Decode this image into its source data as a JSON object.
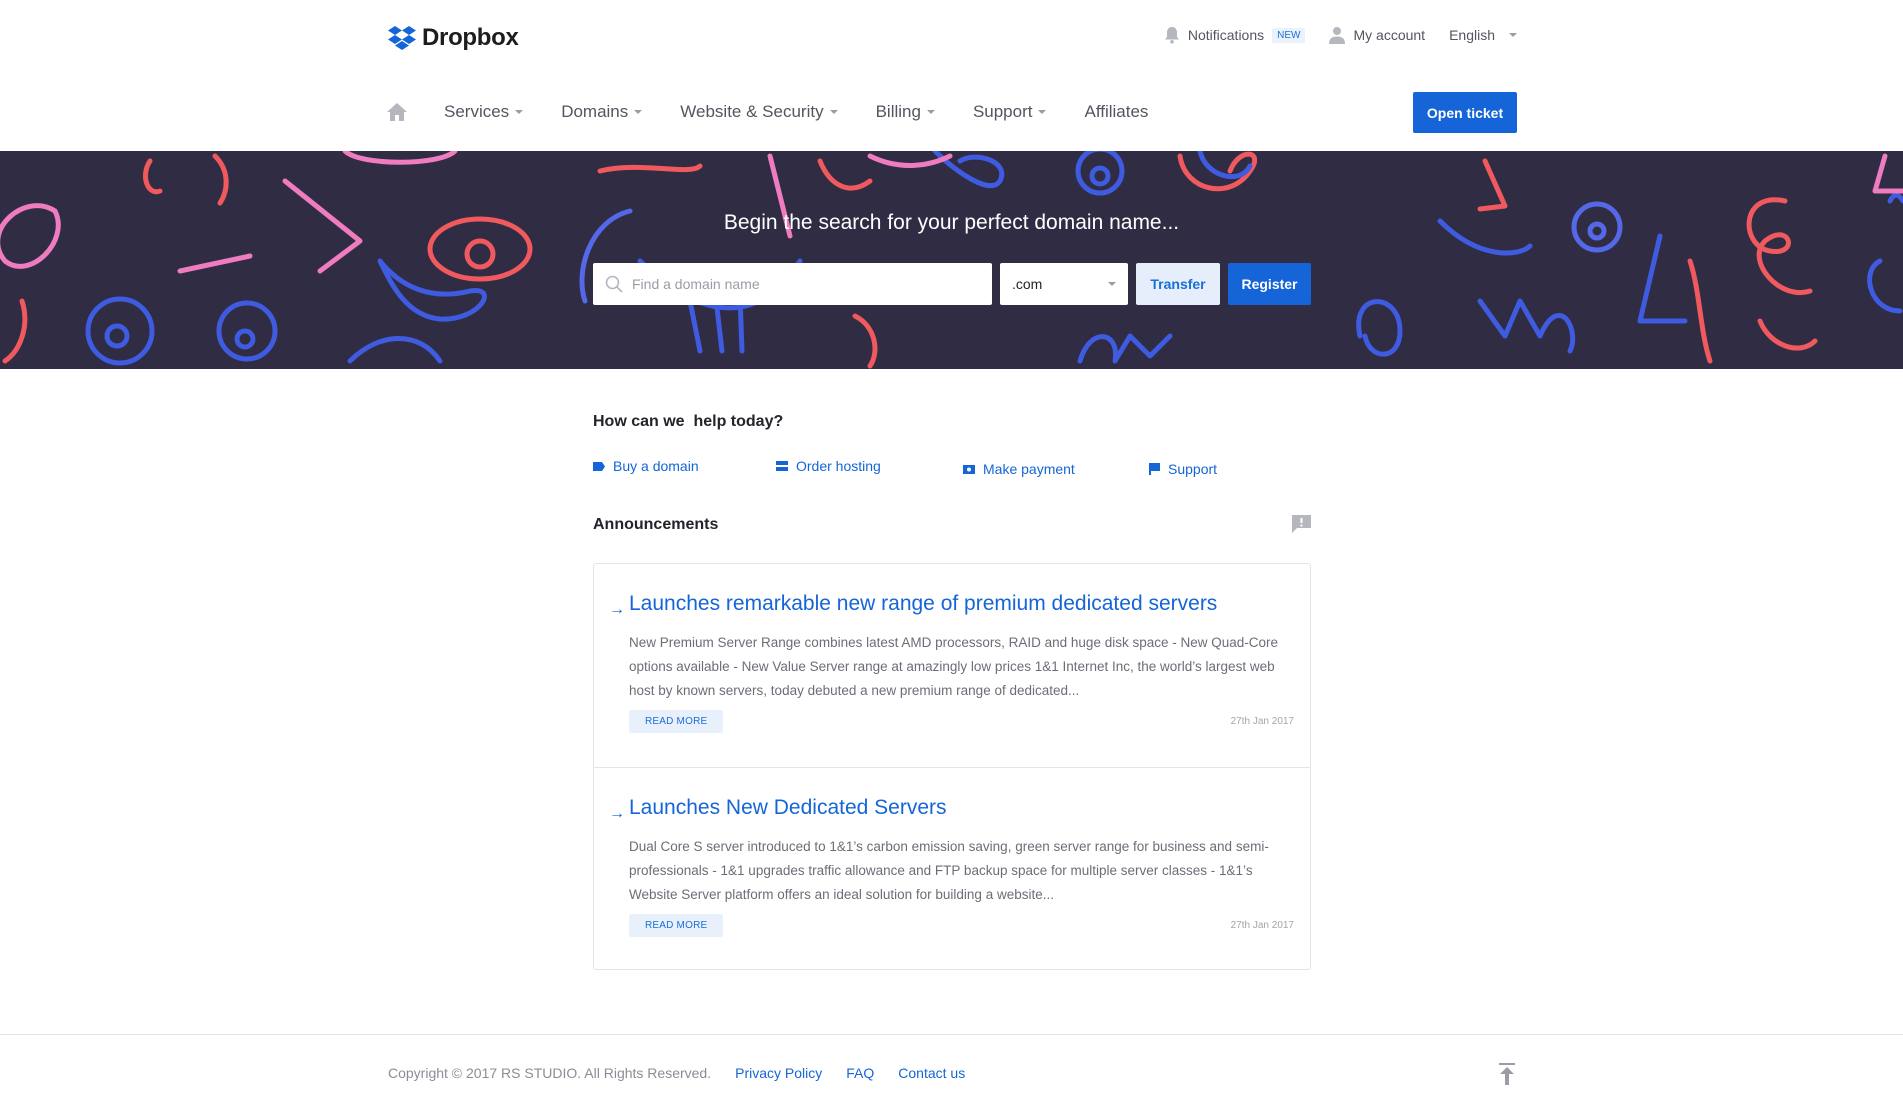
{
  "brand": {
    "name": "Dropbox",
    "color": "#1565d8"
  },
  "top_bar": {
    "notifications_label": "Notifications",
    "notifications_badge": "NEW",
    "account_label": "My account",
    "language_label": "English"
  },
  "nav": {
    "items": [
      {
        "label": "Services"
      },
      {
        "label": "Domains"
      },
      {
        "label": "Website & Security"
      },
      {
        "label": "Billing"
      },
      {
        "label": "Support"
      },
      {
        "label": "Affiliates"
      }
    ],
    "open_ticket_label": "Open ticket"
  },
  "hero": {
    "title": "Begin the search for your perfect domain name...",
    "search_placeholder": "Find a domain name",
    "tld_value": ".com",
    "transfer_label": "Transfer",
    "register_label": "Register",
    "background_color": "#2f2c44"
  },
  "help": {
    "title": "How can we  help today?",
    "links": [
      {
        "label": "Buy a domain",
        "icon": "tag-icon"
      },
      {
        "label": "Order hosting",
        "icon": "server-icon"
      },
      {
        "label": "Make payment",
        "icon": "payment-icon"
      },
      {
        "label": "Support",
        "icon": "flag-icon"
      }
    ]
  },
  "announcements": {
    "title": "Announcements",
    "items": [
      {
        "heading": "Launches remarkable new range of premium dedicated servers",
        "body": "New Premium Server Range combines latest AMD processors, RAID and huge disk space - New Quad-Core options available - New Value Server range at amazingly low prices 1&1 Internet Inc, the world’s largest web host by known servers, today debuted a new premium range of dedicated...",
        "read_more": "READ MORE",
        "date": "27th Jan 2017"
      },
      {
        "heading": "Launches New Dedicated Servers",
        "body": "Dual Core S server introduced to 1&1’s carbon emission saving, green server range for business and semi-professionals - 1&1 upgrades traffic allowance and FTP backup space for multiple server classes - 1&1’s Website Server platform offers an ideal solution for building a website...",
        "read_more": "READ MORE",
        "date": "27th Jan 2017"
      }
    ]
  },
  "footer": {
    "copyright": "Copyright © 2017 RS STUDIO. All Rights Reserved.",
    "links": [
      {
        "label": "Privacy Policy"
      },
      {
        "label": "FAQ"
      },
      {
        "label": "Contact us"
      }
    ]
  }
}
